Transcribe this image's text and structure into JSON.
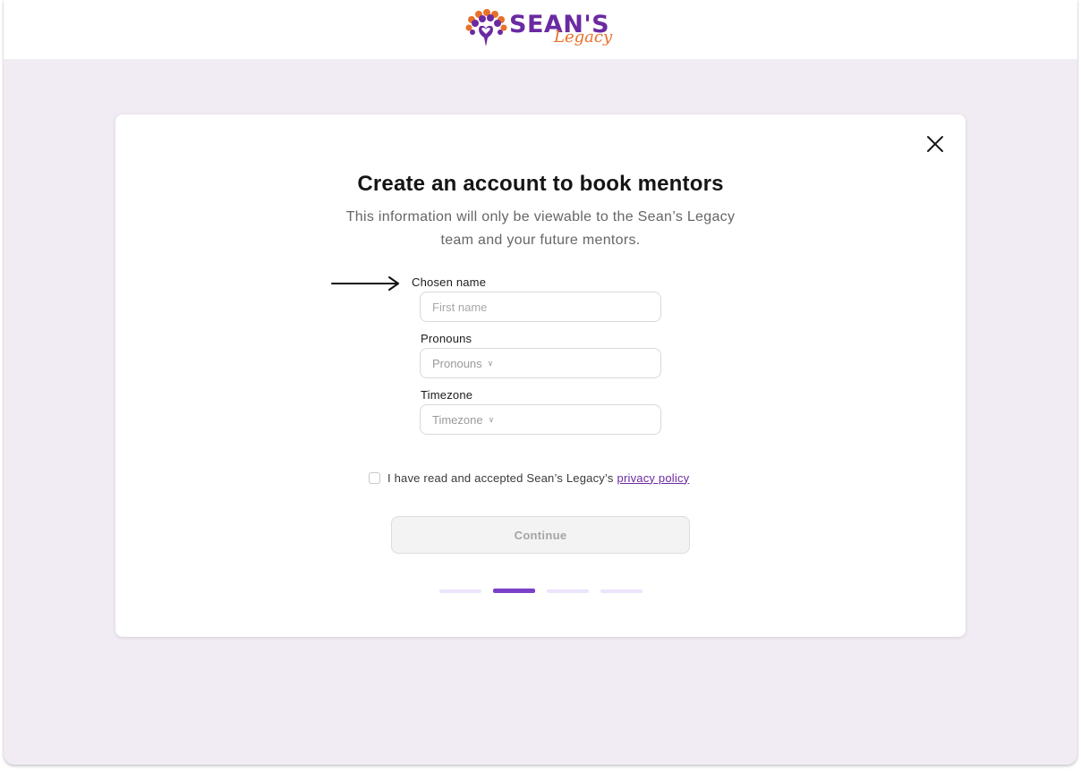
{
  "brand": {
    "name_main": "SEAN'S",
    "name_sub": "Legacy",
    "primary_color": "#6a2aa1",
    "accent_color": "#e8702a"
  },
  "modal": {
    "title": "Create an account to book mentors",
    "subtitle": "This information will only be viewable to the Sean’s Legacy team and your future mentors.",
    "close_icon": "close-icon"
  },
  "form": {
    "chosen_name": {
      "label": "Chosen name",
      "value": "",
      "placeholder": "First name"
    },
    "pronouns": {
      "label": "Pronouns",
      "selected": "Pronouns"
    },
    "timezone": {
      "label": "Timezone",
      "selected": "Timezone"
    },
    "consent": {
      "text": "I have read and accepted Sean’s Legacy’s",
      "link_text": "privacy policy",
      "checked": false
    },
    "continue_label": "Continue"
  },
  "progress": {
    "total_steps": 4,
    "current_step": 2,
    "active_color": "#7b3fc8",
    "inactive_color": "#ece4fb"
  }
}
